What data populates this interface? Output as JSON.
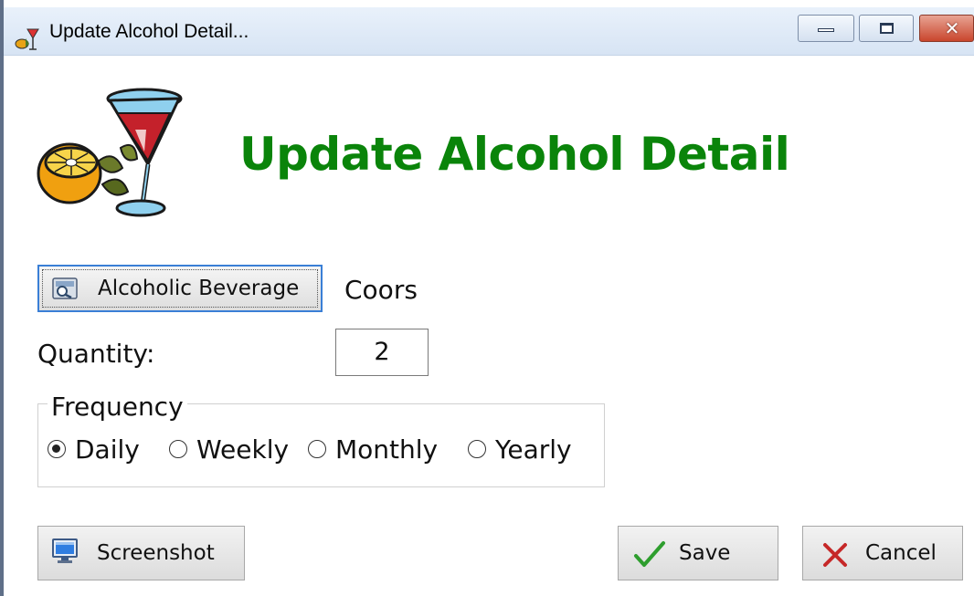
{
  "window": {
    "title": "Update Alcohol Detail...",
    "icon": "drink-app-icon",
    "controls": {
      "minimize": "minimize-icon",
      "maximize": "maximize-icon",
      "close": "close-icon"
    }
  },
  "header": {
    "logo": "cocktail-lemon-clipart",
    "title": "Update Alcohol Detail"
  },
  "beverage": {
    "button_label": "Alcoholic Beverage",
    "button_icon": "lookup-icon",
    "value": "Coors"
  },
  "quantity": {
    "label": "Quantity:",
    "value": "2"
  },
  "frequency": {
    "legend": "Frequency",
    "selected": "Daily",
    "options": [
      "Daily",
      "Weekly",
      "Monthly",
      "Yearly"
    ]
  },
  "buttons": {
    "screenshot": "Screenshot",
    "save": "Save",
    "cancel": "Cancel"
  },
  "colors": {
    "heading": "#0a840a",
    "focus_border": "#3a7fd6",
    "save_check": "#2e9e2e",
    "cancel_x": "#c62828"
  }
}
